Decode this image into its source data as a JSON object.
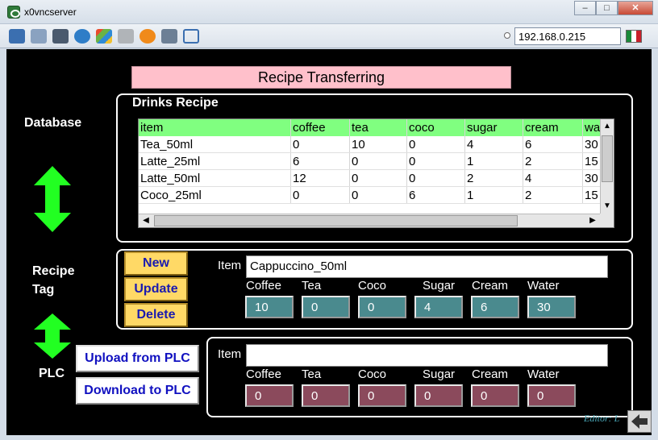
{
  "window": {
    "title": "x0vncserver",
    "minimize": "–",
    "maximize": "□",
    "close": "✕"
  },
  "toolbar": {
    "ip": "192.168.0.215"
  },
  "hmi": {
    "banner": "Recipe Transferring",
    "labels": {
      "database": "Database",
      "recipe": "Recipe",
      "tag": "Tag",
      "plc": "PLC"
    },
    "drinks": {
      "title": "Drinks Recipe",
      "columns": [
        "item",
        "coffee",
        "tea",
        "coco",
        "sugar",
        "cream",
        "wa"
      ],
      "rows": [
        [
          "Tea_50ml",
          "0",
          "10",
          "0",
          "4",
          "6",
          "30"
        ],
        [
          "Latte_25ml",
          "6",
          "0",
          "0",
          "1",
          "2",
          "15"
        ],
        [
          "Latte_50ml",
          "12",
          "0",
          "0",
          "2",
          "4",
          "30"
        ],
        [
          "Coco_25ml",
          "0",
          "0",
          "6",
          "1",
          "2",
          "15"
        ]
      ]
    },
    "tag_panel": {
      "new": "New",
      "update": "Update",
      "delete": "Delete",
      "item_label": "Item",
      "item_value": "Cappuccino_50ml",
      "fields": [
        "Coffee",
        "Tea",
        "Coco",
        "Sugar",
        "Cream",
        "Water"
      ],
      "values": [
        "10",
        "0",
        "0",
        "4",
        "6",
        "30"
      ]
    },
    "plc_panel": {
      "upload": "Upload from PLC",
      "download": "Download to PLC",
      "item_label": "Item",
      "item_value": "",
      "fields": [
        "Coffee",
        "Tea",
        "Coco",
        "Sugar",
        "Cream",
        "Water"
      ],
      "values": [
        "0",
        "0",
        "0",
        "0",
        "0",
        "0"
      ]
    },
    "editor": "Editor: L"
  },
  "colors": {
    "banner": "#ffc0cb",
    "header": "#80ff80",
    "arrow": "#22ff22",
    "tag_value": "#4a8a8e",
    "plc_value": "#8b4a5c",
    "button": "#ffd966"
  }
}
